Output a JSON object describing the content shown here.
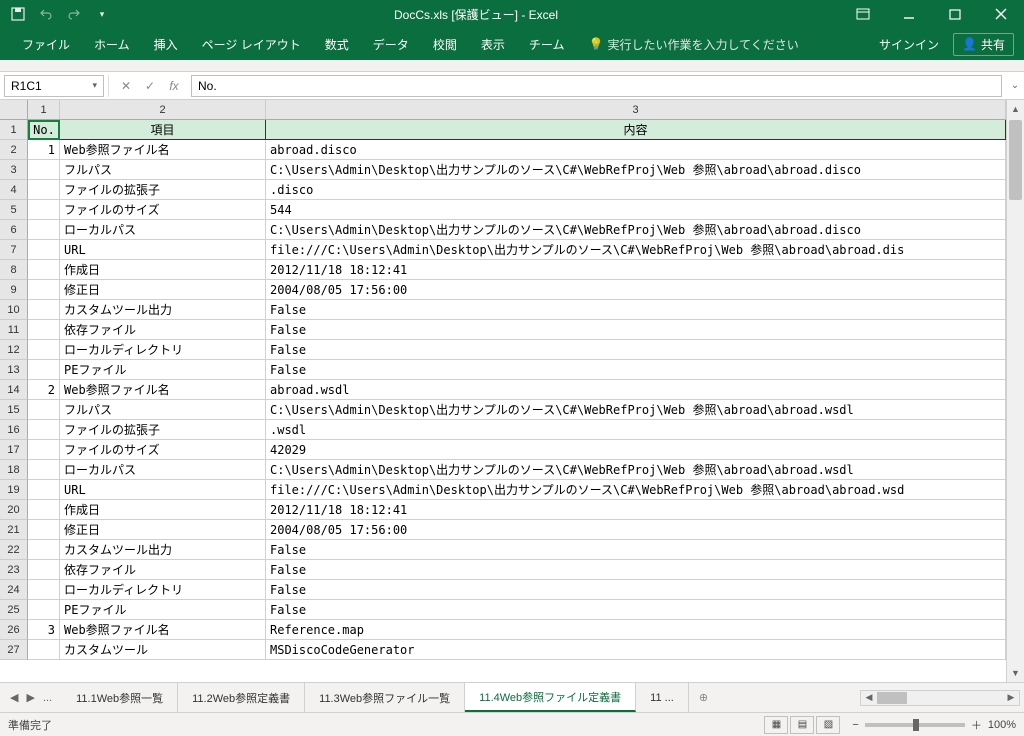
{
  "app": {
    "title": "DocCs.xls [保護ビュー] - Excel",
    "signin": "サインイン",
    "share": "共有"
  },
  "ribbon": {
    "tabs": [
      "ファイル",
      "ホーム",
      "挿入",
      "ページ レイアウト",
      "数式",
      "データ",
      "校閲",
      "表示",
      "チーム"
    ],
    "tellme": "実行したい作業を入力してください"
  },
  "formula_bar": {
    "namebox": "R1C1",
    "formula": "No."
  },
  "columns": {
    "c1": "1",
    "c2": "2",
    "c3": "3"
  },
  "headers": {
    "c1": "No.",
    "c2": "項目",
    "c3": "内容"
  },
  "rows": [
    {
      "n": "1",
      "no": "",
      "a": "",
      "b": ""
    },
    {
      "n": "2",
      "no": "1",
      "a": "Web参照ファイル名",
      "b": "abroad.disco"
    },
    {
      "n": "3",
      "no": "",
      "a": "フルパス",
      "b": "C:\\Users\\Admin\\Desktop\\出力サンプルのソース\\C#\\WebRefProj\\Web 参照\\abroad\\abroad.disco"
    },
    {
      "n": "4",
      "no": "",
      "a": "ファイルの拡張子",
      "b": ".disco"
    },
    {
      "n": "5",
      "no": "",
      "a": "ファイルのサイズ",
      "b": "544"
    },
    {
      "n": "6",
      "no": "",
      "a": "ローカルパス",
      "b": "C:\\Users\\Admin\\Desktop\\出力サンプルのソース\\C#\\WebRefProj\\Web 参照\\abroad\\abroad.disco"
    },
    {
      "n": "7",
      "no": "",
      "a": "URL",
      "b": "file:///C:\\Users\\Admin\\Desktop\\出力サンプルのソース\\C#\\WebRefProj\\Web 参照\\abroad\\abroad.dis"
    },
    {
      "n": "8",
      "no": "",
      "a": "作成日",
      "b": "2012/11/18 18:12:41"
    },
    {
      "n": "9",
      "no": "",
      "a": "修正日",
      "b": "2004/08/05 17:56:00"
    },
    {
      "n": "10",
      "no": "",
      "a": "カスタムツール出力",
      "b": "False"
    },
    {
      "n": "11",
      "no": "",
      "a": "依存ファイル",
      "b": "False"
    },
    {
      "n": "12",
      "no": "",
      "a": "ローカルディレクトリ",
      "b": "False"
    },
    {
      "n": "13",
      "no": "",
      "a": "PEファイル",
      "b": "False"
    },
    {
      "n": "14",
      "no": "2",
      "a": "Web参照ファイル名",
      "b": "abroad.wsdl"
    },
    {
      "n": "15",
      "no": "",
      "a": "フルパス",
      "b": "C:\\Users\\Admin\\Desktop\\出力サンプルのソース\\C#\\WebRefProj\\Web 参照\\abroad\\abroad.wsdl"
    },
    {
      "n": "16",
      "no": "",
      "a": "ファイルの拡張子",
      "b": ".wsdl"
    },
    {
      "n": "17",
      "no": "",
      "a": "ファイルのサイズ",
      "b": "42029"
    },
    {
      "n": "18",
      "no": "",
      "a": "ローカルパス",
      "b": "C:\\Users\\Admin\\Desktop\\出力サンプルのソース\\C#\\WebRefProj\\Web 参照\\abroad\\abroad.wsdl"
    },
    {
      "n": "19",
      "no": "",
      "a": "URL",
      "b": "file:///C:\\Users\\Admin\\Desktop\\出力サンプルのソース\\C#\\WebRefProj\\Web 参照\\abroad\\abroad.wsd"
    },
    {
      "n": "20",
      "no": "",
      "a": "作成日",
      "b": "2012/11/18 18:12:41"
    },
    {
      "n": "21",
      "no": "",
      "a": "修正日",
      "b": "2004/08/05 17:56:00"
    },
    {
      "n": "22",
      "no": "",
      "a": "カスタムツール出力",
      "b": "False"
    },
    {
      "n": "23",
      "no": "",
      "a": "依存ファイル",
      "b": "False"
    },
    {
      "n": "24",
      "no": "",
      "a": "ローカルディレクトリ",
      "b": "False"
    },
    {
      "n": "25",
      "no": "",
      "a": "PEファイル",
      "b": "False"
    },
    {
      "n": "26",
      "no": "3",
      "a": "Web参照ファイル名",
      "b": "Reference.map"
    },
    {
      "n": "27",
      "no": "",
      "a": "カスタムツール",
      "b": "MSDiscoCodeGenerator"
    }
  ],
  "sheet_tabs": {
    "tabs": [
      "11.1Web参照一覧",
      "11.2Web参照定義書",
      "11.3Web参照ファイル一覧",
      "11.4Web参照ファイル定義書",
      "11 ..."
    ],
    "active": 3,
    "nav_more": "..."
  },
  "status": {
    "ready": "準備完了",
    "zoom": "100%"
  }
}
